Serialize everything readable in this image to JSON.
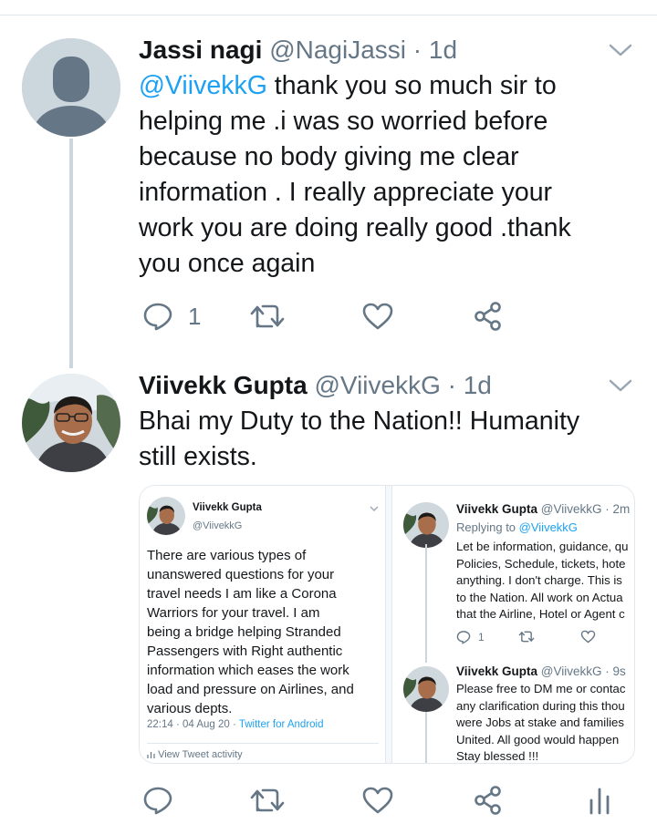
{
  "tweet1": {
    "name": "Jassi nagi",
    "meta": "@NagiJassi · 1d",
    "mention": "@ViivekkG",
    "lines_first": " thank you so much sir to",
    "lines": [
      "helping me .i was so worried before",
      "because no body giving me clear",
      "information . I really appreciate your",
      "work you are doing really good .thank",
      "you once again"
    ],
    "reply_count": "1"
  },
  "tweet2": {
    "name": "Viivekk Gupta",
    "meta": "@ViivekkG · 1d",
    "lines": [
      "Bhai my Duty to the Nation!! Humanity",
      "still exists."
    ]
  },
  "media_left": {
    "name": "Viivekk Gupta",
    "handle": "@ViivekkG",
    "text_lines": [
      "There are various types of",
      "unanswered questions for your",
      "travel needs I am like a Corona",
      "Warriors for your travel. I am",
      "being a bridge helping Stranded",
      "Passengers with Right authentic",
      "information which eases the work",
      "load and pressure on Airlines, and",
      "various depts."
    ],
    "time": "22:14 · 04 Aug 20 · ",
    "app": "Twitter for Android",
    "activity": "View Tweet activity"
  },
  "media_right": {
    "post1": {
      "name": "Viivekk Gupta",
      "meta": " @ViivekkG · 2m",
      "replying": "Replying to ",
      "replying_to": "@ViivekkG",
      "lines": [
        "Let be information, guidance, qu",
        "Policies, Schedule, tickets, hote",
        "anything. I don't charge. This is",
        "to the Nation. All work on Actua",
        "that the Airline, Hotel or Agent c"
      ],
      "reply_count": "1"
    },
    "post2": {
      "name": "Viivekk Gupta",
      "meta": " @ViivekkG · 9s",
      "lines": [
        "Please free to DM me or contac",
        "any clarification during this thou",
        "were Jobs at stake and families",
        "United. All good would happen",
        "Stay blessed !!!"
      ]
    }
  },
  "colors": {
    "accent": "#1da1f2",
    "secondary_text": "#657786",
    "icon": "#657786",
    "divider": "#e1e8ed",
    "thread_line": "#ccd6dd"
  },
  "icons": [
    "reply-icon",
    "retweet-icon",
    "like-icon",
    "share-icon",
    "chevron-down-icon",
    "analytics-icon"
  ]
}
